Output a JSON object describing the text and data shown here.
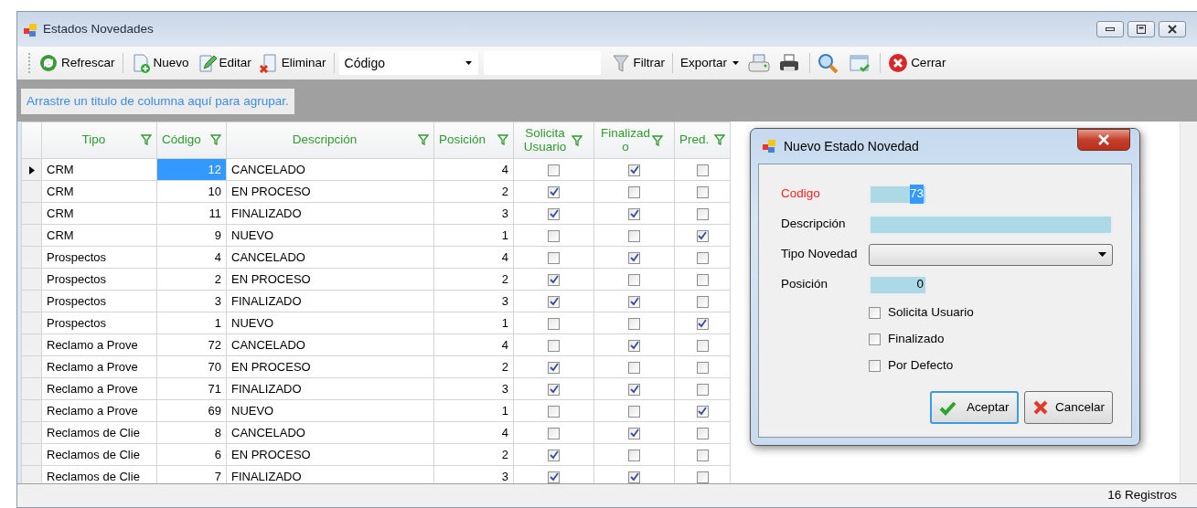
{
  "window": {
    "title": "Estados Novedades"
  },
  "toolbar": [
    {
      "kind": "button",
      "label": "Refrescar"
    },
    {
      "kind": "button",
      "label": "Nuevo"
    },
    {
      "kind": "button",
      "label": "Editar"
    },
    {
      "kind": "button",
      "label": "Eliminar"
    },
    {
      "kind": "combo",
      "value": "Código"
    },
    {
      "kind": "field"
    },
    {
      "kind": "button",
      "label": "Filtrar"
    },
    {
      "kind": "menu",
      "label": "Exportar"
    },
    {
      "kind": "icon"
    },
    {
      "kind": "icon"
    },
    {
      "kind": "icon"
    },
    {
      "kind": "icon"
    },
    {
      "kind": "button",
      "label": "Cerrar"
    }
  ],
  "group_panel": {
    "hint": "Arrastre un titulo de columna aquí para agrupar."
  },
  "table": {
    "columns": [
      "Tipo",
      "Código",
      "Descripción",
      "Posición",
      "Solicita Usuario",
      "Finalizad o",
      "Pred."
    ],
    "rows": [
      {
        "selected": true,
        "tipo": "CRM",
        "codigo": "12",
        "descripcion": "CANCELADO",
        "posicion": "4",
        "solicita": false,
        "finalizado": true,
        "pred": false
      },
      {
        "selected": false,
        "tipo": "CRM",
        "codigo": "10",
        "descripcion": "EN PROCESO",
        "posicion": "2",
        "solicita": true,
        "finalizado": false,
        "pred": false
      },
      {
        "selected": false,
        "tipo": "CRM",
        "codigo": "11",
        "descripcion": "FINALIZADO",
        "posicion": "3",
        "solicita": true,
        "finalizado": true,
        "pred": false
      },
      {
        "selected": false,
        "tipo": "CRM",
        "codigo": "9",
        "descripcion": "NUEVO",
        "posicion": "1",
        "solicita": false,
        "finalizado": false,
        "pred": true
      },
      {
        "selected": false,
        "tipo": "Prospectos",
        "codigo": "4",
        "descripcion": "CANCELADO",
        "posicion": "4",
        "solicita": false,
        "finalizado": true,
        "pred": false
      },
      {
        "selected": false,
        "tipo": "Prospectos",
        "codigo": "2",
        "descripcion": "EN PROCESO",
        "posicion": "2",
        "solicita": true,
        "finalizado": false,
        "pred": false
      },
      {
        "selected": false,
        "tipo": "Prospectos",
        "codigo": "3",
        "descripcion": "FINALIZADO",
        "posicion": "3",
        "solicita": true,
        "finalizado": true,
        "pred": false
      },
      {
        "selected": false,
        "tipo": "Prospectos",
        "codigo": "1",
        "descripcion": "NUEVO",
        "posicion": "1",
        "solicita": false,
        "finalizado": false,
        "pred": true
      },
      {
        "selected": false,
        "tipo": "Reclamo a Prove",
        "codigo": "72",
        "descripcion": "CANCELADO",
        "posicion": "4",
        "solicita": false,
        "finalizado": true,
        "pred": false
      },
      {
        "selected": false,
        "tipo": "Reclamo a Prove",
        "codigo": "70",
        "descripcion": "EN PROCESO",
        "posicion": "2",
        "solicita": true,
        "finalizado": false,
        "pred": false
      },
      {
        "selected": false,
        "tipo": "Reclamo a Prove",
        "codigo": "71",
        "descripcion": "FINALIZADO",
        "posicion": "3",
        "solicita": true,
        "finalizado": true,
        "pred": false
      },
      {
        "selected": false,
        "tipo": "Reclamo a Prove",
        "codigo": "69",
        "descripcion": "NUEVO",
        "posicion": "1",
        "solicita": false,
        "finalizado": false,
        "pred": true
      },
      {
        "selected": false,
        "tipo": "Reclamos de Clie",
        "codigo": "8",
        "descripcion": "CANCELADO",
        "posicion": "4",
        "solicita": false,
        "finalizado": true,
        "pred": false
      },
      {
        "selected": false,
        "tipo": "Reclamos de Clie",
        "codigo": "6",
        "descripcion": "EN PROCESO",
        "posicion": "2",
        "solicita": true,
        "finalizado": false,
        "pred": false
      },
      {
        "selected": false,
        "tipo": "Reclamos de Clie",
        "codigo": "7",
        "descripcion": "FINALIZADO",
        "posicion": "3",
        "solicita": true,
        "finalizado": true,
        "pred": false
      }
    ]
  },
  "status_bar": {
    "count": "16 Registros"
  },
  "dialog": {
    "title": "Nuevo Estado Novedad",
    "fields": [
      {
        "kind": "short",
        "label": "Codigo",
        "required": true,
        "value": "73",
        "highlighted": true
      },
      {
        "kind": "long",
        "label": "Descripción",
        "required": false
      },
      {
        "kind": "select",
        "label": "Tipo Novedad",
        "required": false
      },
      {
        "kind": "short",
        "label": "Posición",
        "required": false,
        "value": "0",
        "highlighted": false
      }
    ],
    "checks": [
      {
        "label": "Solicita Usuario",
        "checked": false
      },
      {
        "label": "Finalizado",
        "checked": false
      },
      {
        "label": "Por Defecto",
        "checked": false
      }
    ],
    "buttons": [
      {
        "kind": "ok",
        "label": "Aceptar",
        "default": true
      },
      {
        "kind": "cancel",
        "label": "Cancelar",
        "default": false
      }
    ]
  }
}
